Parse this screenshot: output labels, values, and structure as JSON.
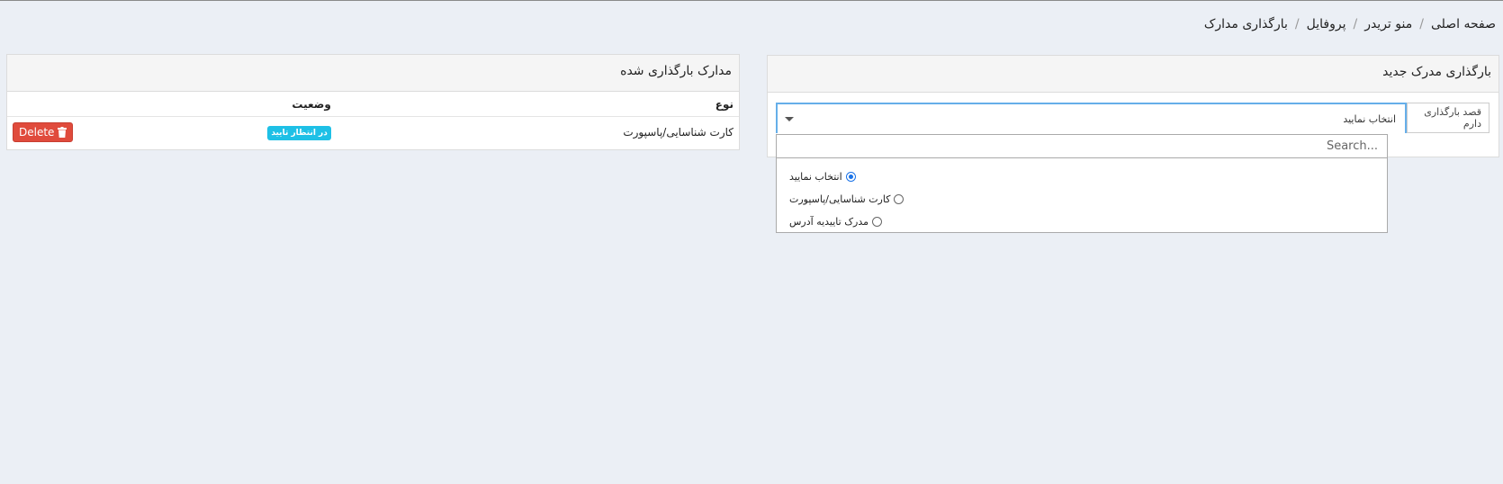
{
  "breadcrumb": {
    "items": [
      "صفحه اصلی",
      "منو تریدر",
      "پروفایل",
      "بارگذاری مدارک"
    ],
    "separator": "/"
  },
  "uploaded_panel": {
    "title": "مدارک بارگذاری شده",
    "columns": [
      "نوع",
      "وضعیت"
    ],
    "rows": [
      {
        "type": "کارت شناسایی/پاسپورت",
        "status": "در انتظار تایید",
        "action": "Delete"
      }
    ]
  },
  "new_panel": {
    "title": "بارگذاری مدرک جدید",
    "addon_label": "قصد بارگذاری دارم",
    "selected_value": "انتخاب نمایید"
  },
  "dropdown": {
    "search_placeholder": "Search...",
    "options": [
      {
        "label": "انتخاب نمایید",
        "checked": true
      },
      {
        "label": "کارت شناسایی/پاسپورت",
        "checked": false
      },
      {
        "label": "مدرک تاییدیه آدرس",
        "checked": false
      }
    ]
  },
  "colors": {
    "background": "#ebeff5",
    "badge": "#1ec0e6",
    "delete": "#e04b3c",
    "focus": "#66afe9"
  }
}
